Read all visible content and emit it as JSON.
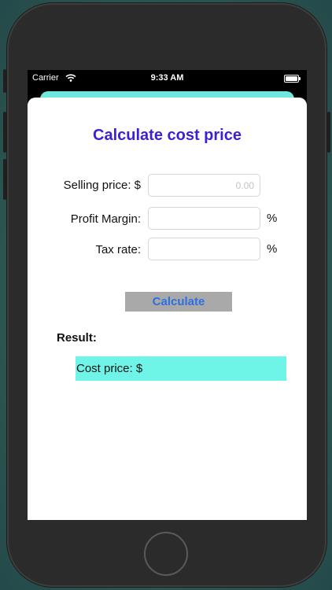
{
  "status_bar": {
    "carrier": "Carrier",
    "time": "9:33 AM"
  },
  "colors": {
    "accent": "#3d1fd6",
    "result_background": "#6ff5e8",
    "card_back": "#6ee7dd",
    "button_background": "#a9a9a9",
    "button_text": "#2f6fe0"
  },
  "form": {
    "title": "Calculate cost price",
    "selling_price": {
      "label": "Selling price: $",
      "placeholder": "0.00",
      "value": ""
    },
    "profit_margin": {
      "label": "Profit Margin:",
      "value": "",
      "unit": "%"
    },
    "tax_rate": {
      "label": "Tax rate:",
      "value": "",
      "unit": "%"
    },
    "calculate_label": "Calculate"
  },
  "result": {
    "label": "Result:",
    "text": "Cost price: $"
  },
  "icons": [
    "wifi-icon",
    "battery-icon",
    "home-button"
  ]
}
